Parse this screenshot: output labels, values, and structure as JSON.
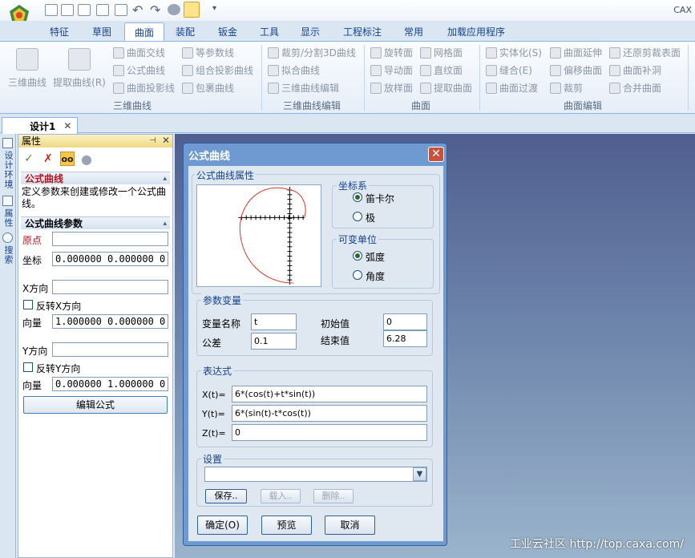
{
  "app": {
    "title": "CAX"
  },
  "tabs": [
    {
      "label": "特征"
    },
    {
      "label": "草图"
    },
    {
      "label": "曲面"
    },
    {
      "label": "装配"
    },
    {
      "label": "钣金"
    },
    {
      "label": "工具"
    },
    {
      "label": "显示"
    },
    {
      "label": "工程标注"
    },
    {
      "label": "常用"
    },
    {
      "label": "加载应用程序"
    }
  ],
  "ribbon": {
    "curve3d": {
      "big": [
        "三维曲线",
        "提取曲线(R)"
      ],
      "items": [
        "曲面交线",
        "等参数线",
        "公式曲线",
        "组合投影曲线",
        "曲面投影线",
        "包裹曲线"
      ],
      "label": "三维曲线"
    },
    "curve_edit": {
      "items": [
        "裁剪/分割3D曲线",
        "拟合曲线",
        "三维曲线编辑"
      ],
      "label": "三维曲线编辑"
    },
    "surface": {
      "items": [
        "旋转面",
        "网格面",
        "导动面",
        "直纹面",
        "放样面",
        "提取曲面"
      ],
      "label": "曲面"
    },
    "surface_edit": {
      "items": [
        "实体化(S)",
        "曲面延伸",
        "还原剪裁表面",
        "缝合(E)",
        "偏移曲面",
        "曲面补洞",
        "曲面过渡",
        "裁剪",
        "合并曲面"
      ],
      "label": "曲面编辑"
    }
  },
  "doc_tab": {
    "label": "设计1"
  },
  "side_tabs": [
    "设计环境",
    "属性",
    "搜索"
  ],
  "props": {
    "header": "属性",
    "section1_title": "公式曲线",
    "section1_desc": "定义参数来创建或修改一个公式曲线。",
    "section2_title": "公式曲线参数",
    "origin_label": "原点",
    "coord_label": "坐标",
    "coord_value": "0.000000  0.000000  0.0",
    "xdir_label": "X方向",
    "reverse_x": "反转X方向",
    "vector_label": "向量",
    "xvec_value": "1.000000  0.000000  0.0",
    "ydir_label": "Y方向",
    "reverse_y": "反转Y方向",
    "yvec_value": "0.000000  1.000000  0.0",
    "edit_formula": "编辑公式"
  },
  "dialog": {
    "title": "公式曲线",
    "props_group": "公式曲线属性",
    "coord_group": "坐标系",
    "cartesian": "笛卡尔",
    "polar": "极",
    "unit_group": "可变单位",
    "radian": "弧度",
    "degree": "角度",
    "param_group": "参数变量",
    "var_name_label": "变量名称",
    "var_name": "t",
    "tol_label": "公差",
    "tol": "0.1",
    "start_label": "初始值",
    "start": "0",
    "end_label": "结束值",
    "end": "6.28",
    "expr_group": "表达式",
    "x_label": "X(t)=",
    "x_expr": "6*(cos(t)+t*sin(t))",
    "y_label": "Y(t)=",
    "y_expr": "6*(sin(t)-t*cos(t))",
    "z_label": "Z(t)=",
    "z_expr": "0",
    "settings_group": "设置",
    "save": "保存..",
    "load": "载入..",
    "delete": "删除..",
    "ok": "确定(O)",
    "preview": "预览",
    "cancel": "取消"
  },
  "watermark": "工业云社区 http://top.caxa.com/"
}
